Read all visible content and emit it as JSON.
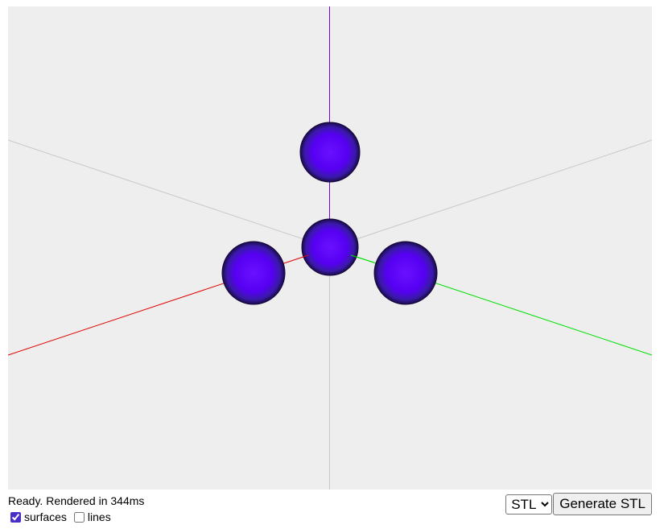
{
  "status": {
    "text": "Ready. Rendered in 344ms"
  },
  "options": {
    "surfaces_label": "surfaces",
    "surfaces_checked": true,
    "lines_label": "lines",
    "lines_checked": false
  },
  "export": {
    "format_selected": "STL",
    "format_options": [
      "STL"
    ],
    "generate_label": "Generate STL"
  },
  "viewport": {
    "background_color": "#eeeeee",
    "axis_colors": {
      "x_positive": "#e00000",
      "y_positive": "#00e000",
      "z_positive": "#7000e0",
      "negative": "#c8c8c8"
    },
    "sphere_color": "#5500ff",
    "object": "four spheres (one center, three around)"
  }
}
